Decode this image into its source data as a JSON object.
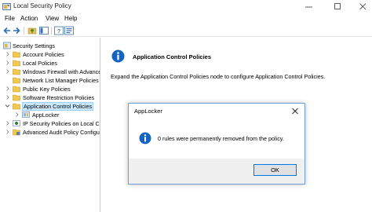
{
  "window": {
    "title": "Local Security Policy",
    "icon": "security-policy-icon"
  },
  "menu": [
    "File",
    "Action",
    "View",
    "Help"
  ],
  "toolbar": [
    "back-arrow-icon",
    "forward-arrow-icon",
    "up-folder-icon",
    "show-hide-tree-icon",
    "help-icon",
    "properties-icon"
  ],
  "tree": {
    "root": "Security Settings",
    "items": [
      {
        "label": "Account Policies",
        "expandable": true,
        "icon": "folder-icon"
      },
      {
        "label": "Local Policies",
        "expandable": true,
        "icon": "folder-icon"
      },
      {
        "label": "Windows Firewall with Advance",
        "expandable": true,
        "icon": "folder-icon"
      },
      {
        "label": "Network List Manager Policies",
        "expandable": false,
        "icon": "folder-icon"
      },
      {
        "label": "Public Key Policies",
        "expandable": true,
        "icon": "folder-icon"
      },
      {
        "label": "Software Restriction Policies",
        "expandable": true,
        "icon": "folder-icon"
      },
      {
        "label": "Application Control Policies",
        "expandable": true,
        "expanded": true,
        "selected": true,
        "icon": "folder-icon"
      },
      {
        "label": "AppLocker",
        "expandable": true,
        "child": true,
        "icon": "applocker-icon"
      },
      {
        "label": "IP Security Policies on Local C",
        "expandable": true,
        "icon": "ip-security-icon"
      },
      {
        "label": "Advanced Audit Policy Configu",
        "expandable": true,
        "icon": "audit-policy-icon"
      }
    ]
  },
  "content": {
    "heading": "Application Control Policies",
    "description": "Expand the Application Control Policies node to configure Application Control Policies."
  },
  "dialog": {
    "title": "AppLocker",
    "message": "0 rules were permanently removed from the policy.",
    "ok_label": "OK"
  },
  "colors": {
    "selection": "#cce8ff",
    "dialog_border": "#6f9ed5",
    "info_blue": "#1565c0",
    "button_focus": "#0078d7"
  }
}
